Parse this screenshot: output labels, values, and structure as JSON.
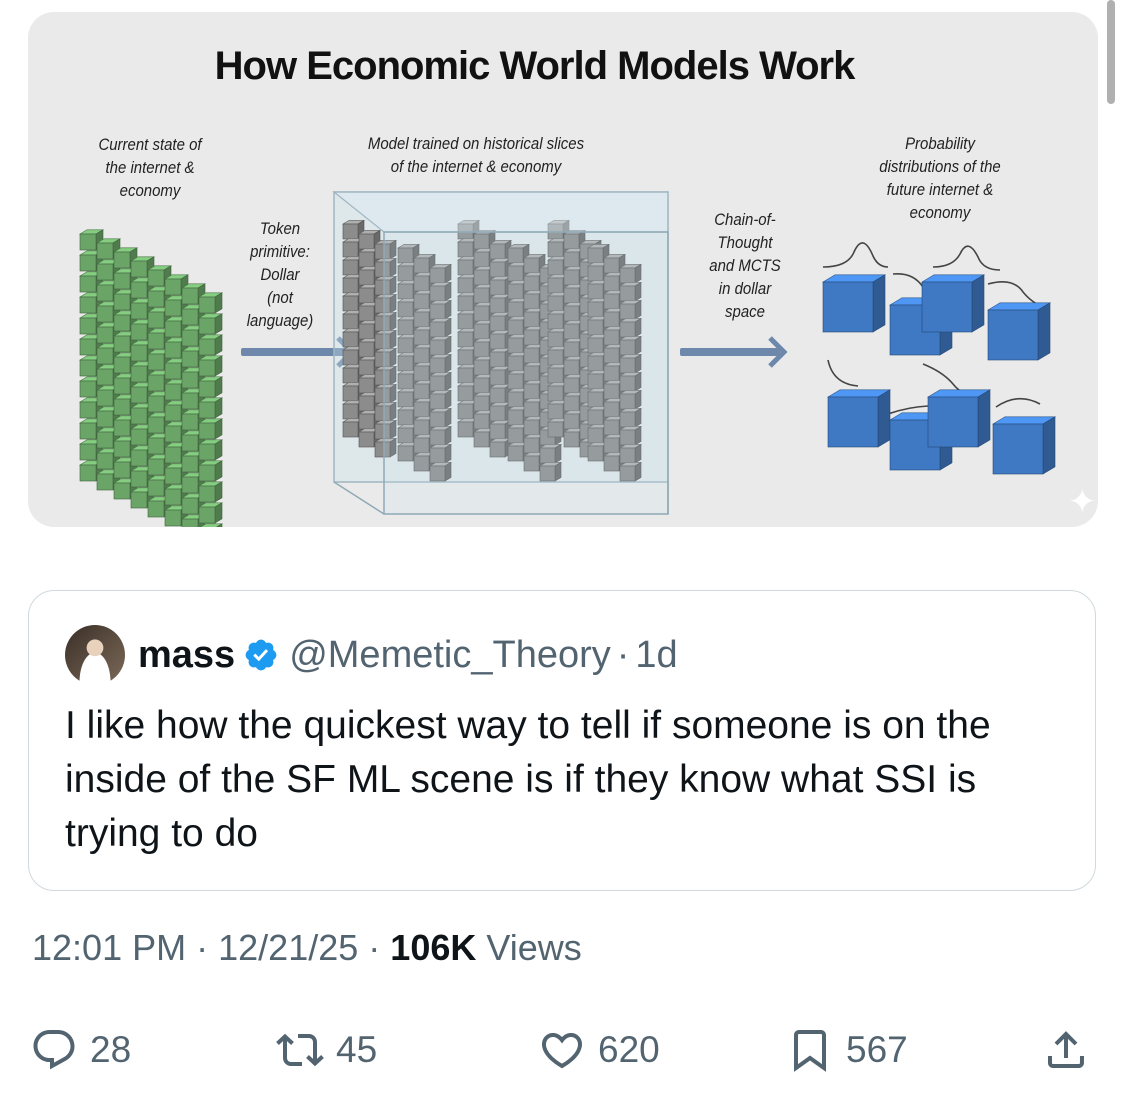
{
  "diagram": {
    "title": "How Economic World Models Work",
    "captions": {
      "left": [
        "Current state of",
        "the internet &",
        "economy"
      ],
      "token": [
        "Token",
        "primitive:",
        "Dollar",
        "(not",
        "language)"
      ],
      "model": [
        "Model trained on historical slices",
        "of the internet & economy"
      ],
      "cot": [
        "Chain-of-",
        "Thought",
        "and MCTS",
        "in dollar",
        "space"
      ],
      "right": [
        "Probability",
        "distributions of the",
        "future internet &",
        "economy"
      ]
    },
    "colors": {
      "green": "#6aa466",
      "gray": "#8c8c8c",
      "blue": "#3f79c3",
      "arrow": "#6d88ab"
    }
  },
  "quote": {
    "name": "mass",
    "handle": "@Memetic_Theory",
    "separator": "·",
    "time": "1d",
    "text": "I like how the quickest way to tell if someone is on the inside of the SF ML scene is if they know what SSI is trying to do",
    "verified_color": "#1d9bf0"
  },
  "meta": {
    "time": "12:01 PM",
    "date": "12/21/25",
    "views_count": "106K",
    "views_label": "Views",
    "separator": "·"
  },
  "actions": {
    "replies": "28",
    "reposts": "45",
    "likes": "620",
    "bookmarks": "567"
  }
}
